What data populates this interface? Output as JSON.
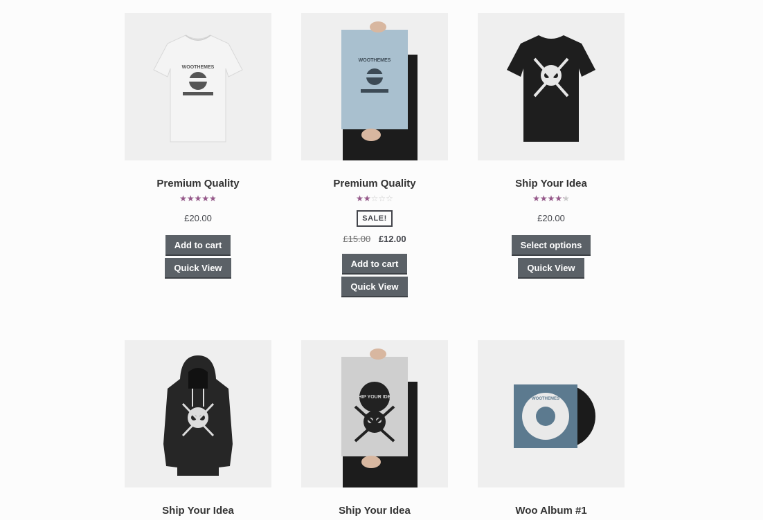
{
  "products": [
    {
      "title": "Premium Quality",
      "rating_fraction": 0.96,
      "price": "£20.00",
      "buttons": [
        "Add to cart",
        "Quick View"
      ]
    },
    {
      "title": "Premium Quality",
      "rating_fraction": 0.4,
      "sale_badge": "SALE!",
      "price_old": "£15.00",
      "price_new": "£12.00",
      "buttons": [
        "Add to cart",
        "Quick View"
      ]
    },
    {
      "title": "Ship Your Idea",
      "rating_fraction": 0.85,
      "price": "£20.00",
      "buttons": [
        "Select options",
        "Quick View"
      ]
    },
    {
      "title": "Ship Your Idea"
    },
    {
      "title": "Ship Your Idea"
    },
    {
      "title": "Woo Album #1"
    }
  ],
  "image_text": {
    "woothemes": "WOOTHEMES",
    "ship_your_idea": "SHIP YOUR IDEA"
  },
  "colors": {
    "rating": "#96588a",
    "button": "#5b6167"
  }
}
